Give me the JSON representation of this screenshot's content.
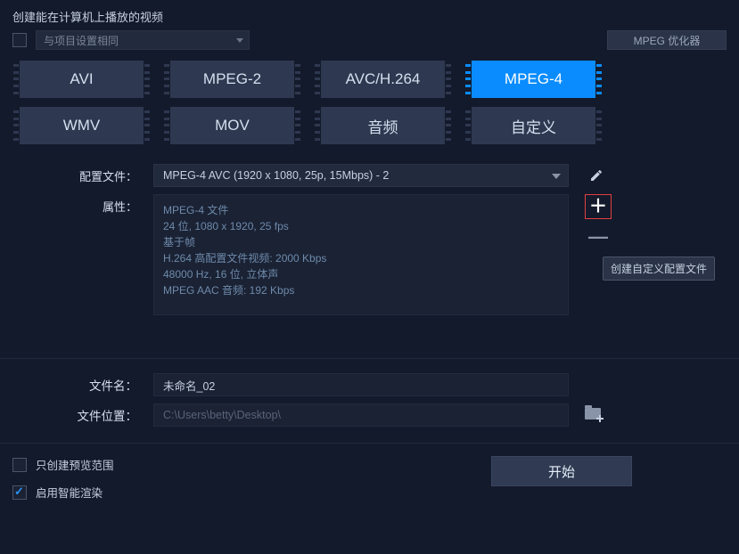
{
  "header": "创建能在计算机上播放的视频",
  "same_as_project": {
    "checked": false,
    "label": "与项目设置相同"
  },
  "optimizer_btn": "MPEG 优化器",
  "formats": [
    {
      "label": "AVI",
      "selected": false
    },
    {
      "label": "MPEG-2",
      "selected": false
    },
    {
      "label": "AVC/H.264",
      "selected": false
    },
    {
      "label": "MPEG-4",
      "selected": true
    },
    {
      "label": "WMV",
      "selected": false
    },
    {
      "label": "MOV",
      "selected": false
    },
    {
      "label": "音频",
      "selected": false
    },
    {
      "label": "自定义",
      "selected": false
    }
  ],
  "profile": {
    "label": "配置文件：",
    "value": "MPEG-4 AVC (1920 x 1080, 25p, 15Mbps) - 2"
  },
  "props": {
    "label": "属性：",
    "lines": [
      "MPEG-4 文件",
      "24 位, 1080 x 1920, 25 fps",
      "基于帧",
      "H.264 高配置文件视频: 2000 Kbps",
      "48000 Hz, 16 位, 立体声",
      "MPEG AAC 音频: 192 Kbps"
    ]
  },
  "tooltip": "创建自定义配置文件",
  "file": {
    "name_label": "文件名：",
    "name_value": "未命名_02",
    "loc_label": "文件位置：",
    "loc_value": "C:\\Users\\betty\\Desktop\\"
  },
  "opts": {
    "preview_only": {
      "checked": false,
      "label": "只创建预览范围"
    },
    "smart_render": {
      "checked": true,
      "label": "启用智能渲染"
    }
  },
  "start_btn": "开始"
}
